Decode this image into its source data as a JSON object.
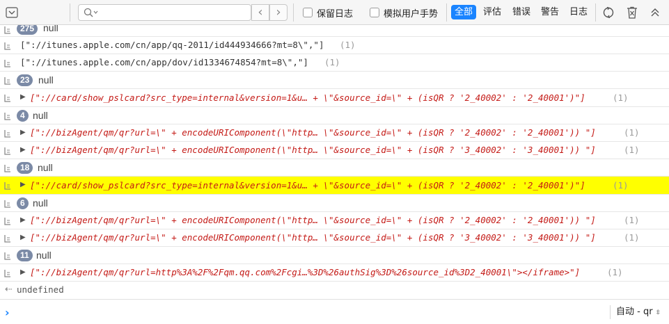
{
  "toolbar": {
    "search_placeholder": "",
    "preserve_log_label": "保留日志",
    "emulate_gesture_label": "模拟用户手势",
    "filters": [
      "全部",
      "评估",
      "错误",
      "警告",
      "日志"
    ],
    "active_filter": "全部",
    "prev_symbol": "‹",
    "next_symbol": "›"
  },
  "log": {
    "rows": [
      {
        "type": "group",
        "count": "275",
        "text": "null"
      },
      {
        "type": "plain",
        "text": "[\"://itunes.apple.com/cn/app/qq-2011/id444934666?mt=8\\\",\"]",
        "count": "(1)"
      },
      {
        "type": "plain",
        "text": "[\"://itunes.apple.com/cn/app/dov/id1334674854?mt=8\\\",\"]",
        "count": "(1)"
      },
      {
        "type": "group",
        "count": "23",
        "text": "null"
      },
      {
        "type": "array",
        "text": "[\"://card/show_pslcard?src_type=internal&version=1&u… + \\\"&source_id=\\\" + (isQR ? '2_40002' : '2_40001')\"]",
        "count": "(1)"
      },
      {
        "type": "group",
        "count": "4",
        "text": "null"
      },
      {
        "type": "array",
        "text": "[\"://bizAgent/qm/qr?url=\\\" + encodeURIComponent(\\\"http… \\\"&source_id=\\\" + (isQR ? '2_40002' : '2_40001')) \"]",
        "count": "(1)"
      },
      {
        "type": "array",
        "text": "[\"://bizAgent/qm/qr?url=\\\" + encodeURIComponent(\\\"http… \\\"&source_id=\\\" + (isQR ? '3_40002' : '3_40001')) \"]",
        "count": "(1)"
      },
      {
        "type": "group",
        "count": "18",
        "text": "null"
      },
      {
        "type": "array",
        "highlight": true,
        "text": "[\"://card/show_pslcard?src_type=internal&version=1&u… + \\\"&source_id=\\\" + (isQR ? '2_40002' : '2_40001')\"]",
        "count": "(1)"
      },
      {
        "type": "group",
        "count": "6",
        "text": "null"
      },
      {
        "type": "array",
        "text": "[\"://bizAgent/qm/qr?url=\\\" + encodeURIComponent(\\\"http… \\\"&source_id=\\\" + (isQR ? '2_40002' : '2_40001')) \"]",
        "count": "(1)"
      },
      {
        "type": "array",
        "text": "[\"://bizAgent/qm/qr?url=\\\" + encodeURIComponent(\\\"http… \\\"&source_id=\\\" + (isQR ? '3_40002' : '3_40001')) \"]",
        "count": "(1)"
      },
      {
        "type": "group",
        "count": "11",
        "text": "null"
      },
      {
        "type": "array",
        "text": "[\"://bizAgent/qm/qr?url=http%3A%2F%2Fqm.qq.com%2Fcgi…%3D%26authSig%3D%26source_id%3D2_40001\\\"></iframe>\"]",
        "count": "(1)"
      },
      {
        "type": "result",
        "text": "undefined"
      }
    ]
  },
  "prompt": {
    "context_label": "自动 - qr"
  },
  "colors": {
    "accent": "#1a84ff",
    "highlight": "#ffff00",
    "string": "#c41a16",
    "badge": "#7b8aa6"
  }
}
